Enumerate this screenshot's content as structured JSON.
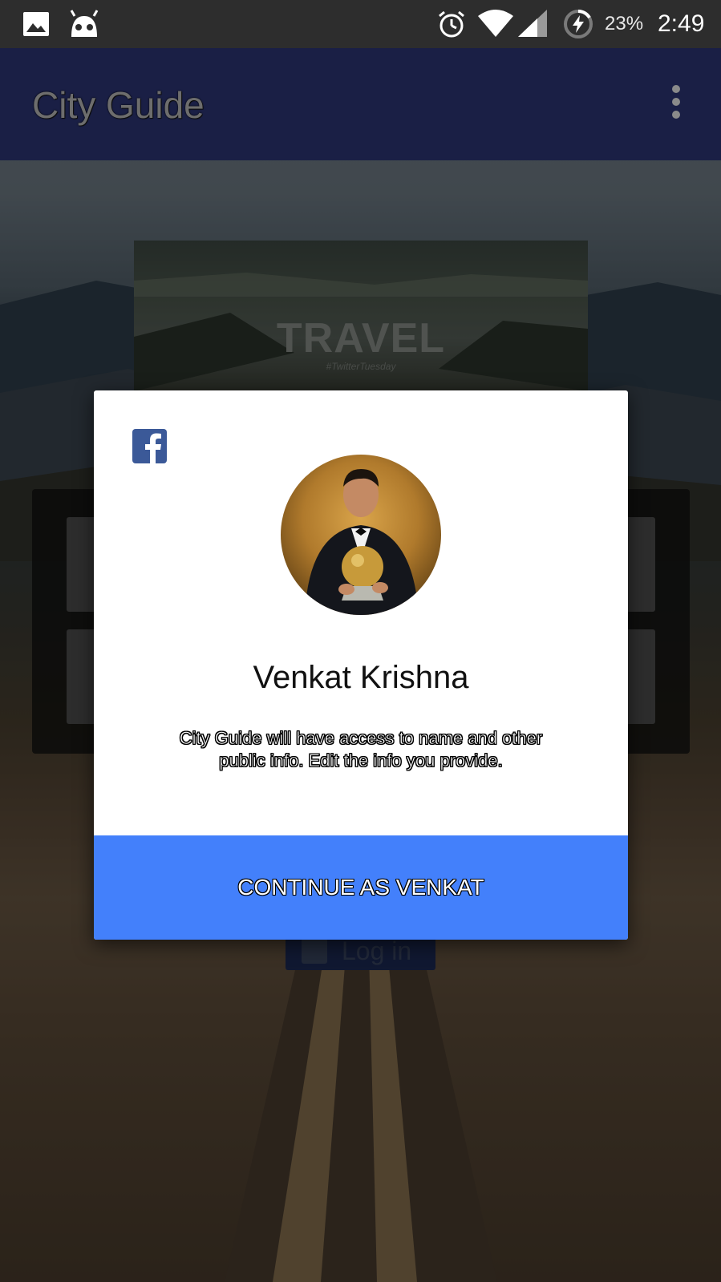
{
  "status_bar": {
    "icons": [
      "image-icon",
      "android-head-icon",
      "alarm-icon",
      "wifi-icon",
      "signal-icon",
      "battery-charging-icon"
    ],
    "battery": "23%",
    "time": "2:49"
  },
  "app_bar": {
    "title": "City Guide",
    "menu_icon": "more-vert-icon"
  },
  "background": {
    "banner_title": "TRAVEL",
    "banner_subtitle": "#TwitterTuesday",
    "login_button_label": "Log in"
  },
  "dialog": {
    "provider_icon": "facebook-icon",
    "user_name": "Venkat Krishna",
    "permission_text": "City Guide will have access to name and other public info. Edit the info you provide.",
    "continue_label": "CONTINUE AS VENKAT",
    "colors": {
      "continue_button": "#4380fb",
      "facebook_blue": "#3b5998",
      "app_bar": "#1a1f45"
    }
  }
}
